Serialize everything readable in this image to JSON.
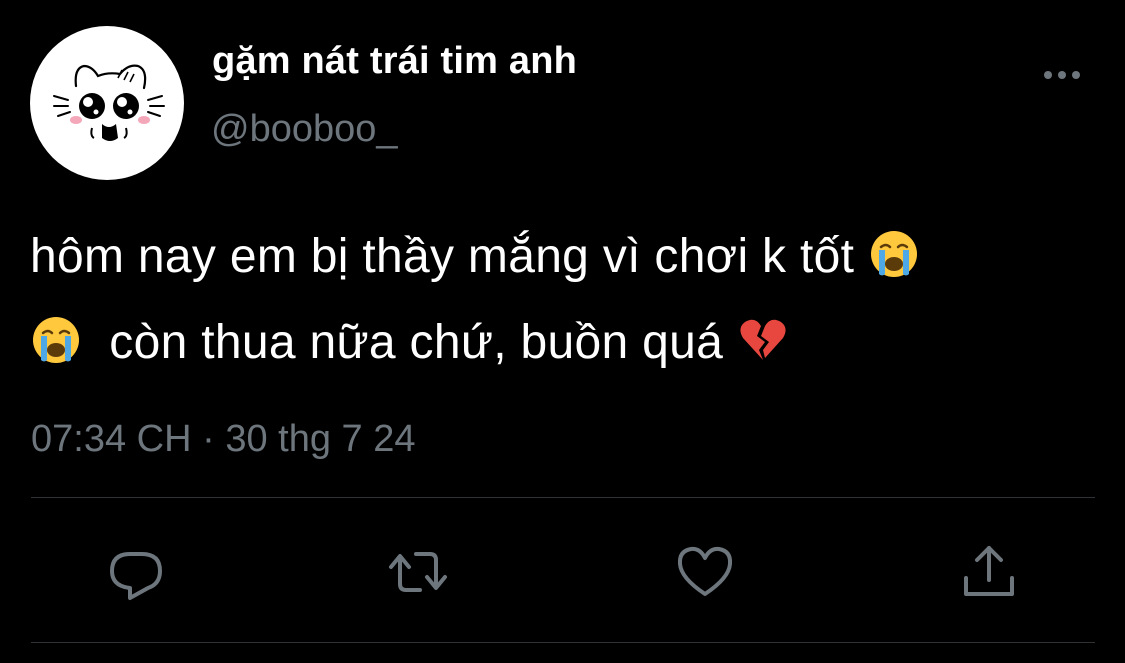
{
  "tweet": {
    "display_name": "gặm nát trái tim anh",
    "handle": "@booboo_",
    "text_line_1": "hôm nay em bị thầy mắng vì chơi k tốt",
    "text_line_2": "còn thua nữa chứ, buồn quá",
    "emoji_1": "crying-face-emoji",
    "emoji_2": "crying-face-emoji",
    "emoji_3": "broken-heart-emoji",
    "time": "07:34 CH",
    "separator": "·",
    "date": "30 thg 7 24"
  },
  "actions": {
    "reply_icon": "speech-bubble-icon",
    "retweet_icon": "retweet-arrows-icon",
    "like_icon": "heart-icon",
    "share_icon": "upload-arrow-icon"
  },
  "colors": {
    "background": "#000000",
    "primary_text": "#ffffff",
    "secondary_text": "#6e767d",
    "divider": "#2f3336",
    "action_icon": "#6e767d"
  }
}
